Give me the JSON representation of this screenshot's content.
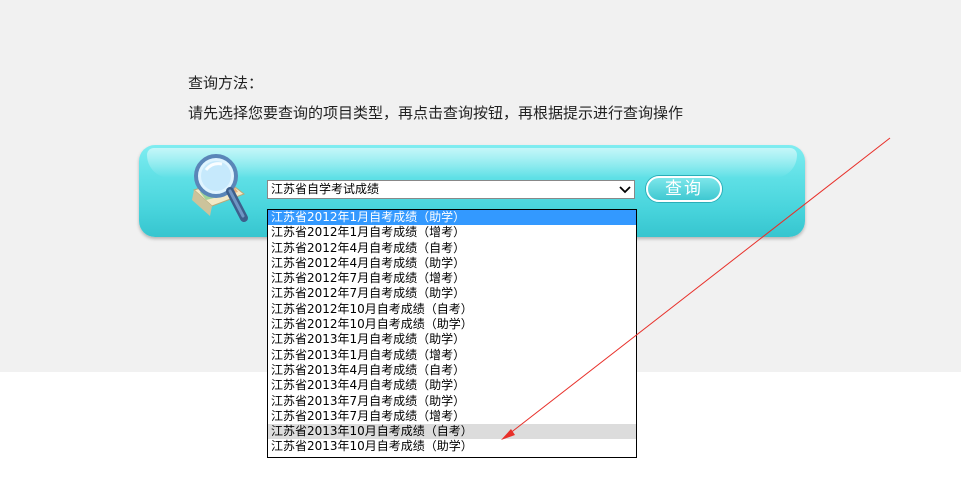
{
  "instructions": {
    "title": "查询方法：",
    "text": "请先选择您要查询的项目类型，再点击查询按钮，再根据提示进行查询操作"
  },
  "select": {
    "current_value": "江苏省自学考试成绩"
  },
  "query_button": {
    "label": "查询"
  },
  "dropdown": {
    "options": [
      "江苏省2012年1月自考成绩（助学）",
      "江苏省2012年1月自考成绩（增考）",
      "江苏省2012年4月自考成绩（自考）",
      "江苏省2012年4月自考成绩（助学）",
      "江苏省2012年7月自考成绩（增考）",
      "江苏省2012年7月自考成绩（助学）",
      "江苏省2012年10月自考成绩（自考）",
      "江苏省2012年10月自考成绩（助学）",
      "江苏省2013年1月自考成绩（助学）",
      "江苏省2013年1月自考成绩（增考）",
      "江苏省2013年4月自考成绩（自考）",
      "江苏省2013年4月自考成绩（助学）",
      "江苏省2013年7月自考成绩（助学）",
      "江苏省2013年7月自考成绩（增考）",
      "江苏省2013年10月自考成绩（自考）",
      "江苏省2013年10月自考成绩（助学）"
    ],
    "selected_index": 0,
    "hover_index": 14
  },
  "colors": {
    "panel": "#5fe0e6",
    "selected_option": "#3399ff",
    "annotation_arrow": "#e8302a"
  }
}
